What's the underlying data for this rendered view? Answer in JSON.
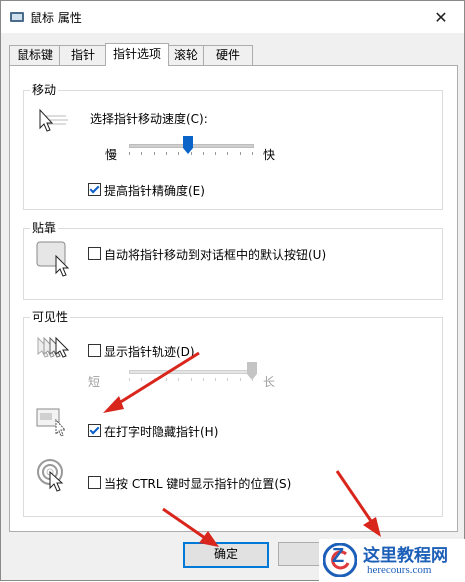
{
  "window": {
    "title": "鼠标 属性",
    "close_glyph": "✕"
  },
  "tabs": [
    {
      "label": "鼠标键"
    },
    {
      "label": "指针"
    },
    {
      "label": "指针选项"
    },
    {
      "label": "滚轮"
    },
    {
      "label": "硬件"
    }
  ],
  "motion": {
    "title": "移动",
    "speed_label": "选择指针移动速度(C):",
    "slow": "慢",
    "fast": "快",
    "speed_level": 0.48,
    "precision_label": "提高指针精确度(E)",
    "precision_checked": true
  },
  "snap": {
    "title": "贴靠",
    "snap_label": "自动将指针移动到对话框中的默认按钮(U)",
    "snap_checked": false
  },
  "visibility": {
    "title": "可见性",
    "trails_label": "显示指针轨迹(D)",
    "trails_checked": false,
    "short": "短",
    "long": "长",
    "trail_level": 1.0,
    "hide_typing_label": "在打字时隐藏指针(H)",
    "hide_typing_checked": true,
    "ctrl_label": "当按 CTRL 键时显示指针的位置(S)",
    "ctrl_checked": false
  },
  "footer": {
    "ok": "确定"
  },
  "watermark": {
    "brand": "这里教程网",
    "url": "herecours.com",
    "logo_letter": "Z"
  },
  "colors": {
    "accent": "#0078d7",
    "annotation_red": "#d9261c",
    "slider_thumb": "#0a64c8"
  }
}
